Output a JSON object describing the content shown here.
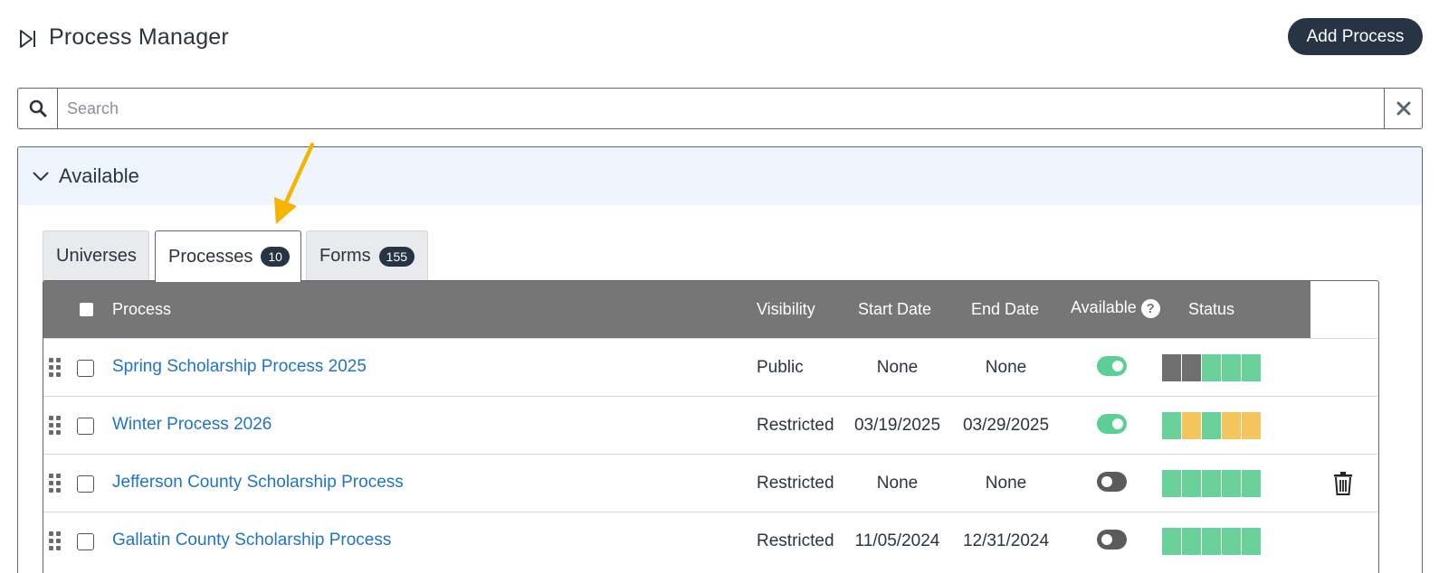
{
  "header": {
    "title": "Process Manager",
    "add_button_label": "Add Process",
    "icon": "step-forward-icon"
  },
  "search": {
    "placeholder": "Search",
    "value": ""
  },
  "panel": {
    "title": "Available"
  },
  "tabs": [
    {
      "label": "Universes",
      "badge": null,
      "active": false
    },
    {
      "label": "Processes",
      "badge": "10",
      "active": true
    },
    {
      "label": "Forms",
      "badge": "155",
      "active": false
    }
  ],
  "table": {
    "columns": {
      "process": "Process",
      "visibility": "Visibility",
      "start_date": "Start Date",
      "end_date": "End Date",
      "available": "Available",
      "status": "Status"
    },
    "help_glyph": "?",
    "rows": [
      {
        "name": "Spring Scholarship Process 2025",
        "visibility": "Public",
        "start_date": "None",
        "end_date": "None",
        "available": true,
        "status": [
          "gray",
          "gray",
          "green",
          "green",
          "green"
        ],
        "deletable": false
      },
      {
        "name": "Winter Process 2026",
        "visibility": "Restricted",
        "start_date": "03/19/2025",
        "end_date": "03/29/2025",
        "available": true,
        "status": [
          "green",
          "yellow",
          "green",
          "yellow",
          "yellow"
        ],
        "deletable": false
      },
      {
        "name": "Jefferson County Scholarship Process",
        "visibility": "Restricted",
        "start_date": "None",
        "end_date": "None",
        "available": false,
        "status": [
          "green",
          "green",
          "green",
          "green",
          "green"
        ],
        "deletable": true
      },
      {
        "name": "Gallatin County Scholarship Process",
        "visibility": "Restricted",
        "start_date": "11/05/2024",
        "end_date": "12/31/2024",
        "available": false,
        "status": [
          "green",
          "green",
          "green",
          "green",
          "green"
        ],
        "deletable": false
      }
    ]
  },
  "colors": {
    "primary": "#263443",
    "link": "#1f74c6",
    "table_header": "#767676",
    "panel_header": "#eef5fd",
    "status_gray": "#6f6f6f",
    "status_green": "#69d09a",
    "status_yellow": "#f3c55c",
    "toggle_on": "#5bcf95",
    "toggle_off": "#5b5b5b",
    "annotation_arrow": "#f5b400"
  }
}
